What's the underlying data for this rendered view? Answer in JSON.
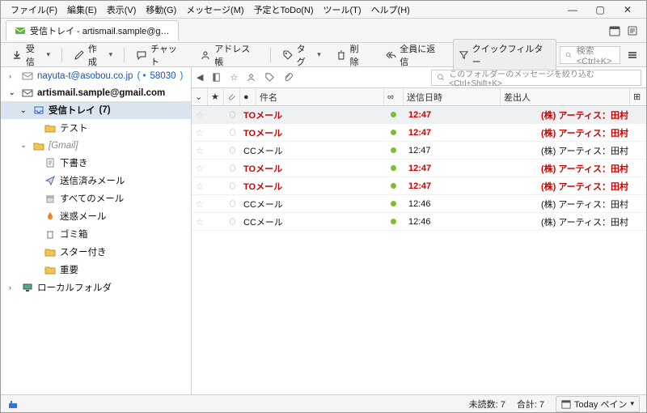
{
  "menu": [
    "ファイル(F)",
    "編集(E)",
    "表示(V)",
    "移動(G)",
    "メッセージ(M)",
    "予定とToDo(N)",
    "ツール(T)",
    "ヘルプ(H)"
  ],
  "tab": {
    "title": "受信トレイ - artismail.sample@g…"
  },
  "toolbar": {
    "receive": "受信",
    "compose": "作成",
    "chat": "チャット",
    "address": "アドレス帳",
    "tag": "タグ",
    "delete": "削除",
    "replyAll": "全員に返信",
    "quick": "クイックフィルター",
    "searchPlaceholder": "検索 <Ctrl+K>"
  },
  "sidebar": {
    "acct1": "nayuta-t@asobou.co.jp",
    "acct1badge": "58030",
    "acct2": "artismail.sample@gmail.com",
    "inbox": "受信トレイ",
    "inboxCount": "(7)",
    "test": "テスト",
    "gmail": "[Gmail]",
    "drafts": "下書き",
    "sent": "送信済みメール",
    "all": "すべてのメール",
    "spam": "迷惑メール",
    "trash": "ゴミ箱",
    "starred": "スター付き",
    "important": "重要",
    "local": "ローカルフォルダ"
  },
  "filter": {
    "placeholder": "このフォルダーのメッセージを絞り込む <Ctrl+Shift+K>"
  },
  "columns": {
    "subject": "件名",
    "date": "送信日時",
    "from": "差出人"
  },
  "messages": [
    {
      "subject": "TOメール",
      "time": "12:47",
      "from": "(株) アーティス：田村",
      "hi": true,
      "sel": true
    },
    {
      "subject": "TOメール",
      "time": "12:47",
      "from": "(株) アーティス：田村",
      "hi": true,
      "sel": false
    },
    {
      "subject": "CCメール",
      "time": "12:47",
      "from": "(株) アーティス：田村",
      "hi": false,
      "sel": false
    },
    {
      "subject": "TOメール",
      "time": "12:47",
      "from": "(株) アーティス：田村",
      "hi": true,
      "sel": false
    },
    {
      "subject": "TOメール",
      "time": "12:47",
      "from": "(株) アーティス：田村",
      "hi": true,
      "sel": false
    },
    {
      "subject": "CCメール",
      "time": "12:46",
      "from": "(株) アーティス：田村",
      "hi": false,
      "sel": false
    },
    {
      "subject": "CCメール",
      "time": "12:46",
      "from": "(株) アーティス：田村",
      "hi": false,
      "sel": false
    }
  ],
  "status": {
    "unread": "未読数: 7",
    "total": "合計: 7",
    "today": "Today ペイン"
  }
}
